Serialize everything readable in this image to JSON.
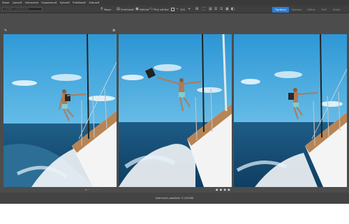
{
  "menu": [
    "Súbor",
    "Upraviť",
    "Informácie",
    "Organizovať",
    "Vytvoriť",
    "Publikovať",
    "Zobraziť"
  ],
  "toolbar": {
    "search_placeholder": "Hľadať v priečinkoch",
    "map_label": "Mapa",
    "preview_label": "Prehliadač",
    "compare_label": "Náhľad",
    "full_label": "Plný náhľad",
    "zoom_value": "100"
  },
  "modes": {
    "active": "Správca",
    "others": [
      "Výstavy",
      "Editor",
      "Tlač",
      "Video"
    ]
  },
  "status": {
    "text": "Vybraných položiek: 3 (10508)"
  },
  "colors": {
    "accent": "#2d7fd6",
    "background": "#4a4a4a"
  }
}
